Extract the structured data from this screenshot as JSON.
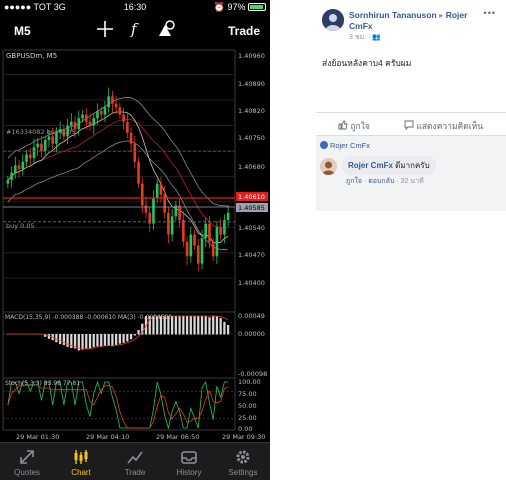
{
  "status_bar": {
    "carrier": "●●●●● TOT 3G",
    "time": "16:30",
    "battery": "97%"
  },
  "toolbar": {
    "timeframe": "M5",
    "trade_label": "Trade",
    "icons": [
      "crosshair-icon",
      "function-icon",
      "objects-icon"
    ]
  },
  "chart": {
    "symbol_label": "GBPUSDm, M5",
    "price_labels": [
      "1.40960",
      "1.40890",
      "1.40820",
      "1.40750",
      "1.40680",
      "1.40610",
      "1.40585",
      "1.40540",
      "1.40470",
      "1.40400"
    ],
    "order_label": "#16334082 buy 0.05",
    "buy_label": "buy 0.05",
    "macd_label": "MACD(15,35,9) -0.000388 -0.000610 MA(3) -0.0004596",
    "macd_scale": [
      "0.00049",
      "0.00000",
      "-0.00098"
    ],
    "stoch_label": "Stoch(5,3,3) 83.98 77.81",
    "stoch_scale": [
      "100.00",
      "75.00",
      "50.00",
      "25.00",
      "0.00"
    ],
    "time_labels": [
      "29 Mar 01:30",
      "29 Mar 04:10",
      "29 Mar 06:50",
      "29 Mar 09:30"
    ],
    "colors": {
      "bull": "#22c55e",
      "bear": "#e63b1f",
      "bid": "#e11d1d",
      "ask_line": "#9ca3af"
    }
  },
  "chart_data": {
    "type": "candlestick",
    "title": "GBPUSDm, M5",
    "ylim": [
      1.4034,
      1.41
    ],
    "x_ticks": [
      "29 Mar 01:30",
      "29 Mar 04:10",
      "29 Mar 06:50",
      "29 Mar 09:30"
    ],
    "y_ticks": [
      1.4096,
      1.4089,
      1.4082,
      1.4075,
      1.4068,
      1.4061,
      1.4054,
      1.4047,
      1.404
    ],
    "current_bid": 1.40585,
    "order_level": 1.40748,
    "buy_level": 1.40555,
    "close": [
      1.4067,
      1.4069,
      1.4071,
      1.407,
      1.4072,
      1.4074,
      1.4073,
      1.4076,
      1.4077,
      1.4075,
      1.4078,
      1.4079,
      1.4077,
      1.408,
      1.4081,
      1.4079,
      1.4082,
      1.4083,
      1.4081,
      1.4084,
      1.4085,
      1.4083,
      1.4082,
      1.4084,
      1.4086,
      1.4085,
      1.4087,
      1.409,
      1.4088,
      1.4087,
      1.4085,
      1.4083,
      1.408,
      1.4077,
      1.4072,
      1.4066,
      1.406,
      1.4058,
      1.4055,
      1.4062,
      1.4066,
      1.4063,
      1.4058,
      1.4052,
      1.4057,
      1.406,
      1.4056,
      1.405,
      1.4046,
      1.4052,
      1.4049,
      1.4044,
      1.4051,
      1.4055,
      1.405,
      1.4046,
      1.4054,
      1.4052,
      1.4056,
      1.4058
    ]
  },
  "tabs": [
    {
      "label": "Quotes",
      "icon": "quotes-icon",
      "active": false
    },
    {
      "label": "Chart",
      "icon": "chart-icon",
      "active": true
    },
    {
      "label": "Trade",
      "icon": "trade-icon",
      "active": false
    },
    {
      "label": "History",
      "icon": "history-icon",
      "active": false
    },
    {
      "label": "Settings",
      "icon": "settings-icon",
      "active": false
    }
  ],
  "post": {
    "author": "Sornhirun Tananuson",
    "arrow": "▸",
    "group": "Rojer CmFx",
    "time": "3 ชม.",
    "privacy_icon": "group-icon",
    "more": "•••",
    "text": "ส่งย้อนหลังคาบ4 ครับผม",
    "like_label": "ถูกใจ",
    "comment_label": "แสดงความคิดเห็น"
  },
  "comment": {
    "reply_link": "Rojer CmFx",
    "author": "Rojer CmFx",
    "text": "ดีมากครับ",
    "like": "ถูกใจ",
    "reply": "ตอบกลับ",
    "time": "32 นาที"
  }
}
